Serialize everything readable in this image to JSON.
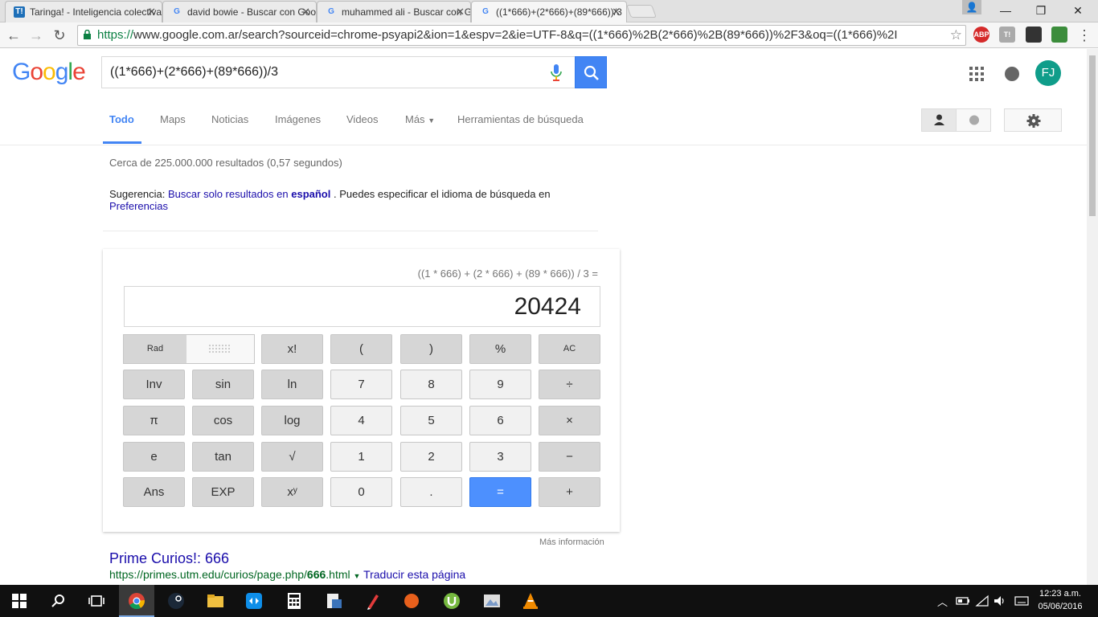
{
  "browser": {
    "tabs": [
      {
        "icon": "T!",
        "title": "Taringa! - Inteligencia colectiva"
      },
      {
        "icon": "G",
        "title": "david bowie - Buscar con Google"
      },
      {
        "icon": "G",
        "title": "muhammed ali - Buscar con Google"
      },
      {
        "icon": "G",
        "title": "((1*666)+(2*666)+(89*666))/3"
      }
    ],
    "url_scheme": "https://",
    "url_rest": "www.google.com.ar/search?sourceid=chrome-psyapi2&ion=1&espv=2&ie=UTF-8&q=((1*666)%2B(2*666)%2B(89*666))%2F3&oq=((1*666)%2I",
    "extensions": [
      "ABP",
      "T!"
    ],
    "window_controls": {
      "minimize": "—",
      "restore": "❐",
      "close": "✕"
    }
  },
  "google": {
    "logo": "Google",
    "query": "((1*666)+(2*666)+(89*666))/3",
    "avatar_initials": "FJ",
    "nav": [
      "Todo",
      "Maps",
      "Noticias",
      "Imágenes",
      "Videos",
      "Más",
      "Herramientas de búsqueda"
    ],
    "stats": "Cerca de 225.000.000 resultados (0,57 segundos)",
    "suggestion": {
      "label": "Sugerencia:",
      "link_prefix": "Buscar solo resultados en",
      "link_bold": "español",
      "middle": ". Puedes especificar el idioma de búsqueda en",
      "prefs": "Preferencias"
    }
  },
  "calculator": {
    "expression": "((1 * 666) + (2 * 666) + (89 * 666)) / 3 =",
    "result": "20424",
    "rad": "Rad",
    "keys_row1": [
      "x!",
      "(",
      ")",
      "%",
      "AC"
    ],
    "keys_row2": [
      "Inv",
      "sin",
      "ln",
      "7",
      "8",
      "9",
      "÷"
    ],
    "keys_row3": [
      "π",
      "cos",
      "log",
      "4",
      "5",
      "6",
      "×"
    ],
    "keys_row4": [
      "e",
      "tan",
      "√",
      "1",
      "2",
      "3",
      "−"
    ],
    "keys_row5": [
      "Ans",
      "EXP",
      "xʸ",
      "0",
      ".",
      "=",
      "+"
    ],
    "more_info": "Más información"
  },
  "result": {
    "title": "Prime Curios!: 666",
    "url_pre": "https://primes.utm.edu/curios/page.php/",
    "url_bold": "666",
    "url_post": ".html",
    "translate": "Traducir esta página"
  },
  "taskbar": {
    "time": "12:23 a.m.",
    "date": "05/06/2016"
  }
}
